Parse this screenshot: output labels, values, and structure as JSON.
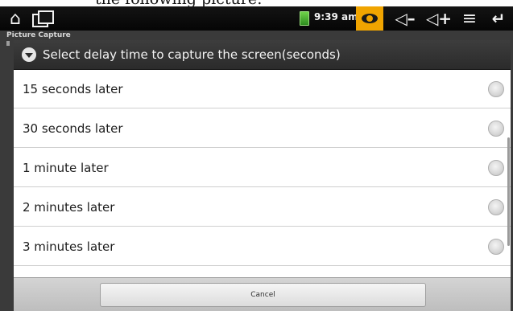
{
  "document": {
    "caption_fragment": "the following picture:"
  },
  "status_bar": {
    "time": "9:39 am",
    "icons": [
      "home-icon",
      "recent-apps-icon",
      "battery-icon",
      "eye-icon",
      "volume-down-icon",
      "volume-up-icon",
      "menu-icon",
      "back-icon"
    ],
    "accent_color": "#f0a400"
  },
  "app": {
    "title": "Picture Capture"
  },
  "dialog": {
    "title": "Select delay time to capture the screen(seconds)",
    "options": [
      {
        "label": "15 seconds later",
        "selected": false
      },
      {
        "label": "30 seconds later",
        "selected": false
      },
      {
        "label": "1 minute later",
        "selected": false
      },
      {
        "label": "2 minutes later",
        "selected": false
      },
      {
        "label": "3 minutes later",
        "selected": false
      }
    ],
    "cancel_label": "Cancel"
  }
}
